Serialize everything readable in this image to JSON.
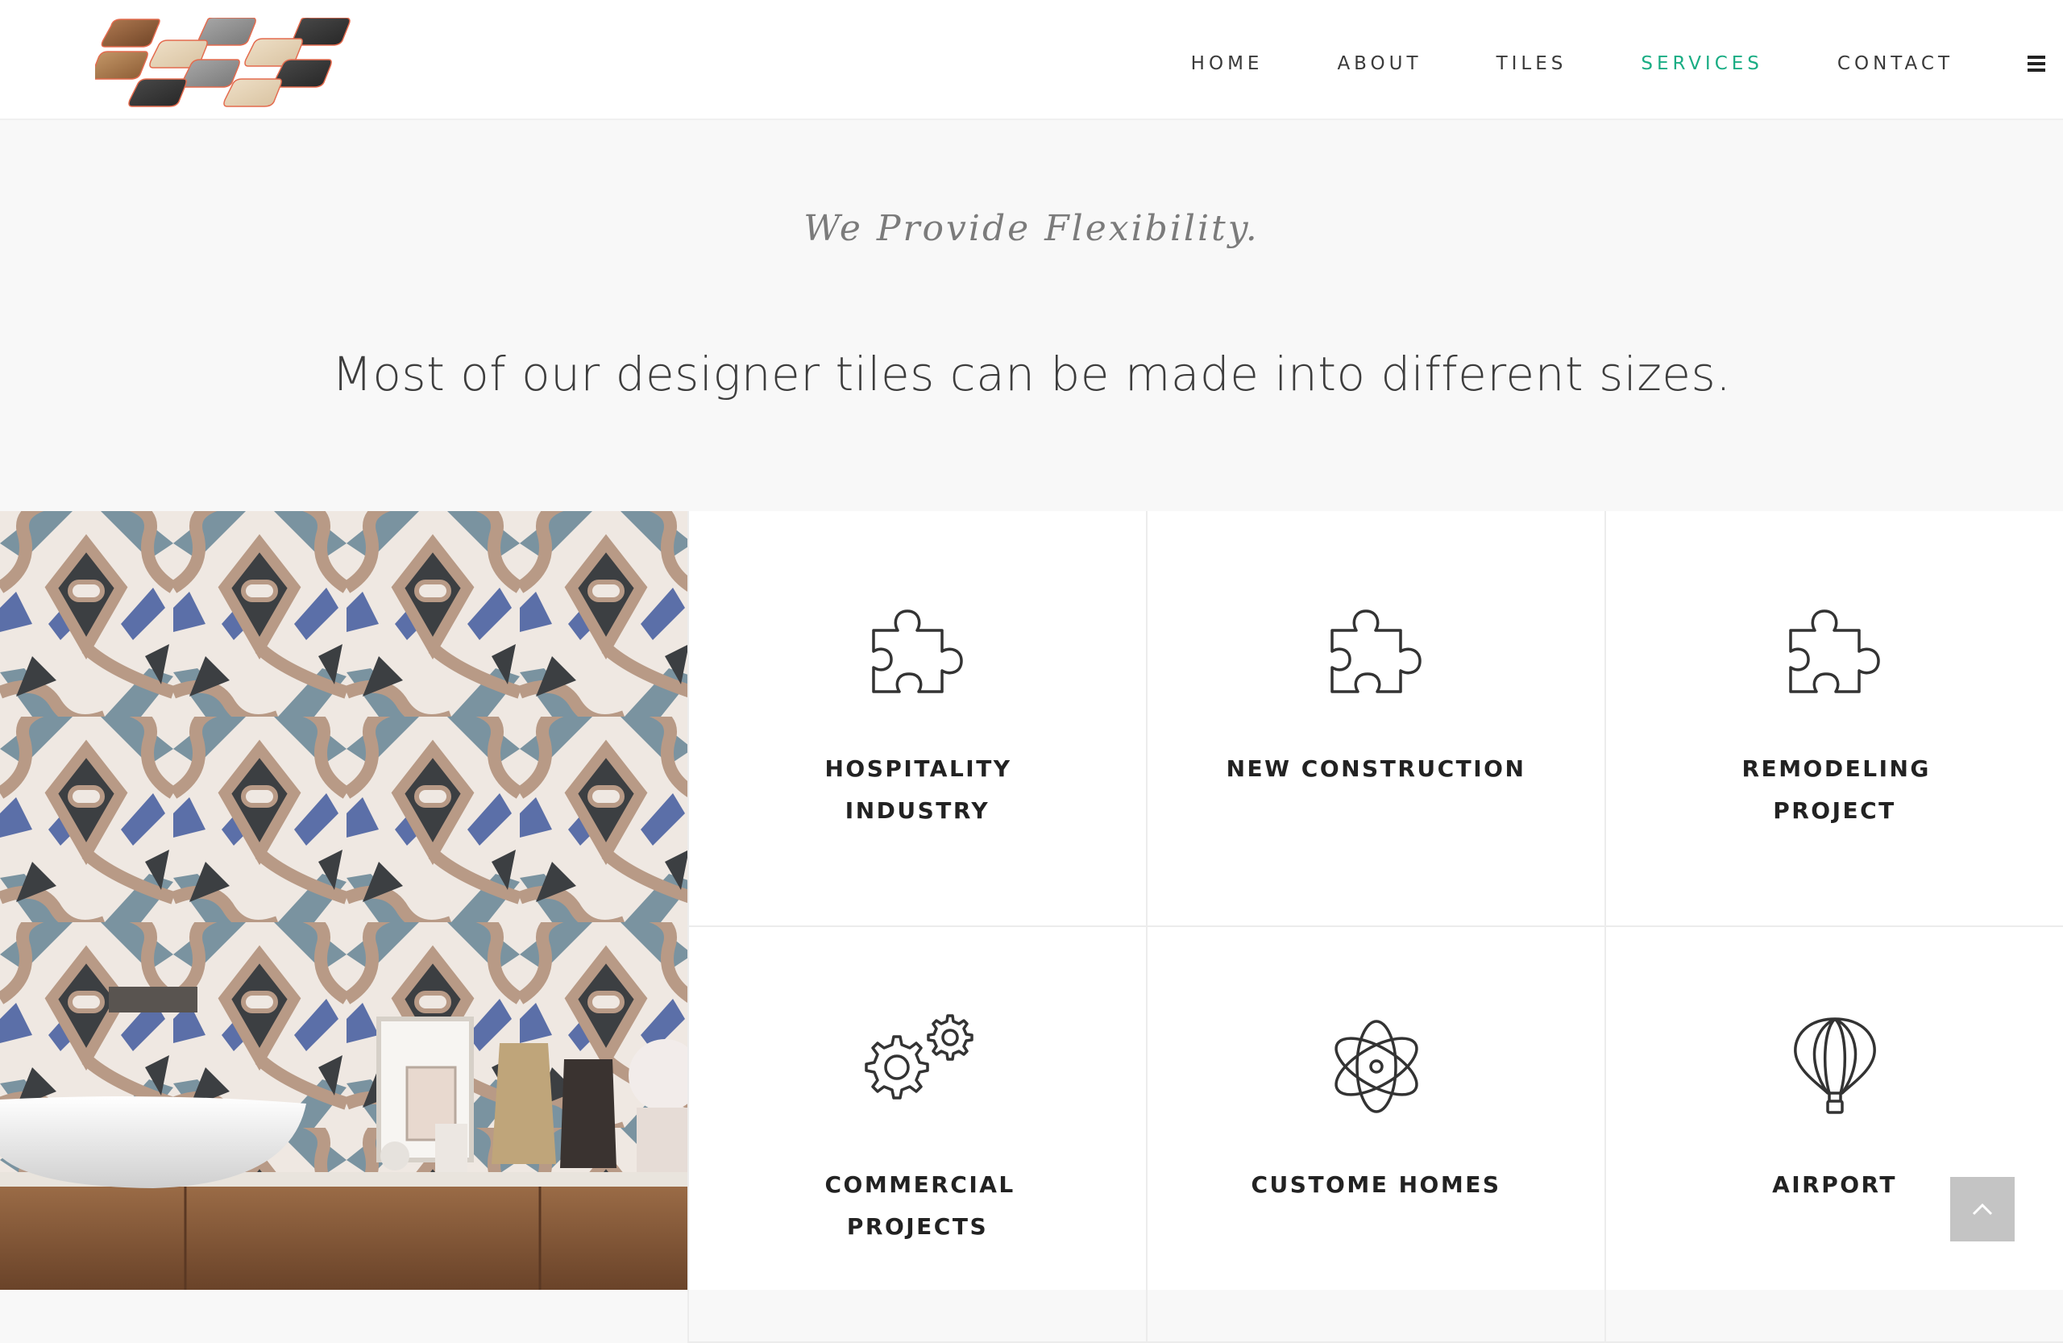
{
  "brand": {
    "logo_icon": "tile-samples-logo"
  },
  "nav": {
    "items": [
      {
        "label": "HOME",
        "active": false
      },
      {
        "label": "ABOUT",
        "active": false
      },
      {
        "label": "TILES",
        "active": false
      },
      {
        "label": "SERVICES",
        "active": true
      },
      {
        "label": "CONTACT",
        "active": false
      }
    ],
    "menu_icon": "hamburger-menu-icon",
    "active_color": "#1aad84"
  },
  "intro": {
    "tagline": "We Provide Flexibility.",
    "headline": "Most of our designer tiles can be made into different sizes."
  },
  "services": [
    {
      "label": "HOSPITALITY INDUSTRY",
      "icon": "puzzle-icon"
    },
    {
      "label": "NEW CONSTRUCTION",
      "icon": "puzzle-icon"
    },
    {
      "label": "REMODELING PROJECT",
      "icon": "puzzle-icon"
    },
    {
      "label": "COMMERCIAL PROJECTS",
      "icon": "gears-icon"
    },
    {
      "label": "CUSTOME HOMES",
      "icon": "atom-icon"
    },
    {
      "label": "AIRPORT",
      "icon": "hot-air-balloon-icon"
    }
  ],
  "back_to_top": {
    "icon": "chevron-up-icon"
  }
}
